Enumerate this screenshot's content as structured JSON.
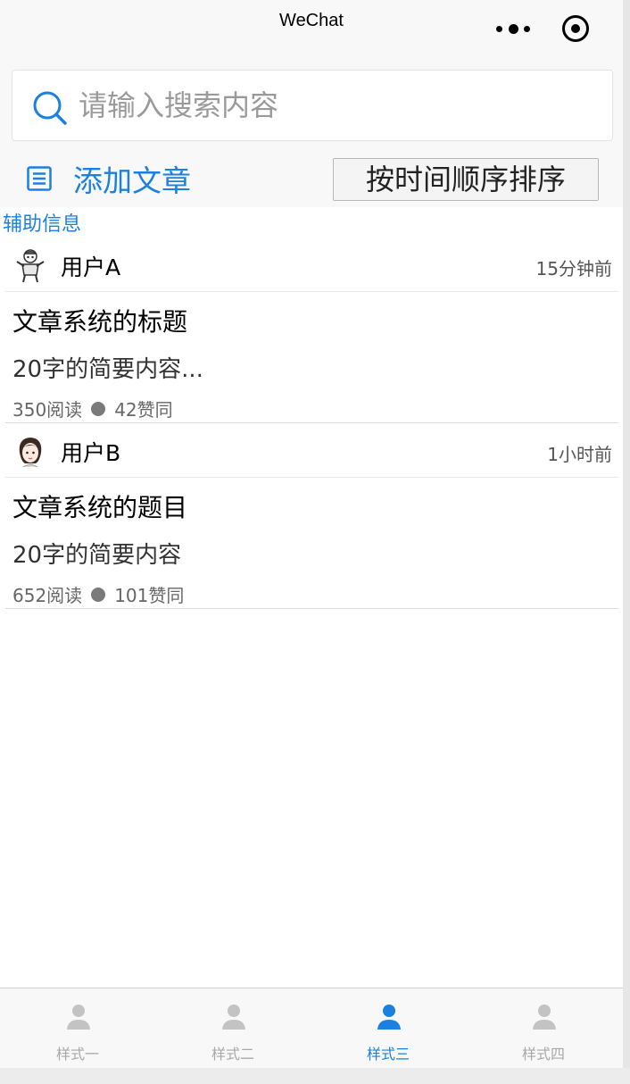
{
  "navbar": {
    "title": "WeChat",
    "more_icon": "more-dots-icon",
    "close_icon": "target-circle-icon"
  },
  "search": {
    "placeholder": "请输入搜索内容",
    "value": "",
    "icon": "search-icon"
  },
  "toolbar": {
    "add_label": "添加文章",
    "add_icon": "list-icon",
    "sort_label": "按时间顺序排序"
  },
  "aux_info": "辅助信息",
  "articles": [
    {
      "user": "用户A",
      "time": "15分钟前",
      "title": "文章系统的标题",
      "summary": "20字的简要内容...",
      "reads": "350阅读",
      "likes": "42赞同",
      "avatar": "cartoon-avatar-icon"
    },
    {
      "user": "用户B",
      "time": "1小时前",
      "title": "文章系统的题目",
      "summary": "20字的简要内容",
      "reads": "652阅读",
      "likes": "101赞同",
      "avatar": "girl-avatar-icon"
    }
  ],
  "tabbar": {
    "active_index": 2,
    "tabs": [
      {
        "label": "样式一",
        "icon": "user-icon"
      },
      {
        "label": "样式二",
        "icon": "user-icon"
      },
      {
        "label": "样式三",
        "icon": "user-icon"
      },
      {
        "label": "样式四",
        "icon": "user-icon"
      }
    ]
  },
  "colors": {
    "accent": "#1b80e0",
    "inactive": "#c3c3c3",
    "background": "#f8f8f8"
  }
}
